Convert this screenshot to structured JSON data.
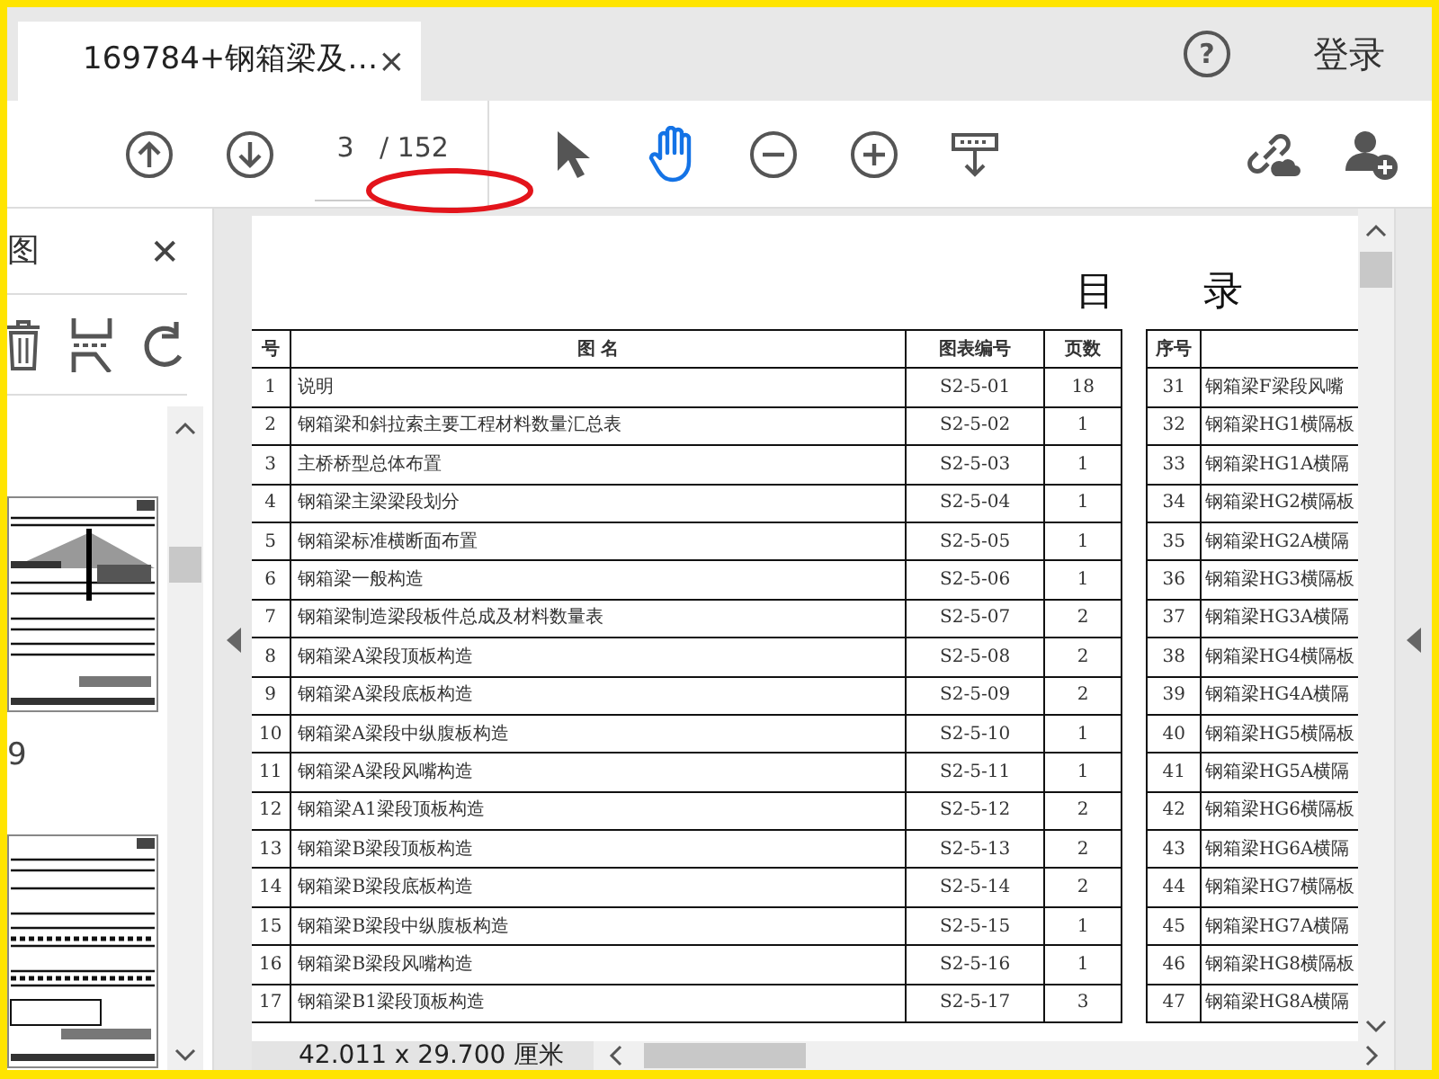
{
  "tab": {
    "title": "169784+钢箱梁及…",
    "close": "×",
    "selected": true
  },
  "header": {
    "help": "?",
    "sign_in": "登录"
  },
  "toolbar": {
    "page_current": "3",
    "page_total": "/ 152",
    "tools": [
      {
        "kind": "select",
        "selected": false
      },
      {
        "kind": "hand",
        "selected": true
      }
    ]
  },
  "sidebar": {
    "title": "图",
    "close": "✕",
    "thumbnail_labels": [
      "9"
    ]
  },
  "document": {
    "title": "目 录",
    "left_table": {
      "columns": [
        "号",
        "图 名",
        "图表编号",
        "页数"
      ],
      "rows": [
        [
          "1",
          "说明",
          "S2-5-01",
          "18"
        ],
        [
          "2",
          "钢箱梁和斜拉索主要工程材料数量汇总表",
          "S2-5-02",
          "1"
        ],
        [
          "3",
          "主桥桥型总体布置",
          "S2-5-03",
          "1"
        ],
        [
          "4",
          "钢箱梁主梁梁段划分",
          "S2-5-04",
          "1"
        ],
        [
          "5",
          "钢箱梁标准横断面布置",
          "S2-5-05",
          "1"
        ],
        [
          "6",
          "钢箱梁一般构造",
          "S2-5-06",
          "1"
        ],
        [
          "7",
          "钢箱梁制造梁段板件总成及材料数量表",
          "S2-5-07",
          "2"
        ],
        [
          "8",
          "钢箱梁A梁段顶板构造",
          "S2-5-08",
          "2"
        ],
        [
          "9",
          "钢箱梁A梁段底板构造",
          "S2-5-09",
          "2"
        ],
        [
          "10",
          "钢箱梁A梁段中纵腹板构造",
          "S2-5-10",
          "1"
        ],
        [
          "11",
          "钢箱梁A梁段风嘴构造",
          "S2-5-11",
          "1"
        ],
        [
          "12",
          "钢箱梁A1梁段顶板构造",
          "S2-5-12",
          "2"
        ],
        [
          "13",
          "钢箱梁B梁段顶板构造",
          "S2-5-13",
          "2"
        ],
        [
          "14",
          "钢箱梁B梁段底板构造",
          "S2-5-14",
          "2"
        ],
        [
          "15",
          "钢箱梁B梁段中纵腹板构造",
          "S2-5-15",
          "1"
        ],
        [
          "16",
          "钢箱梁B梁段风嘴构造",
          "S2-5-16",
          "1"
        ],
        [
          "17",
          "钢箱梁B1梁段顶板构造",
          "S2-5-17",
          "3"
        ]
      ]
    },
    "right_table": {
      "columns": [
        "序号"
      ],
      "rows": [
        [
          "31",
          "钢箱梁F梁段风嘴"
        ],
        [
          "32",
          "钢箱梁HG1横隔板"
        ],
        [
          "33",
          "钢箱梁HG1A横隔"
        ],
        [
          "34",
          "钢箱梁HG2横隔板"
        ],
        [
          "35",
          "钢箱梁HG2A横隔"
        ],
        [
          "36",
          "钢箱梁HG3横隔板"
        ],
        [
          "37",
          "钢箱梁HG3A横隔"
        ],
        [
          "38",
          "钢箱梁HG4横隔板"
        ],
        [
          "39",
          "钢箱梁HG4A横隔"
        ],
        [
          "40",
          "钢箱梁HG5横隔板"
        ],
        [
          "41",
          "钢箱梁HG5A横隔"
        ],
        [
          "42",
          "钢箱梁HG6横隔板"
        ],
        [
          "43",
          "钢箱梁HG6A横隔"
        ],
        [
          "44",
          "钢箱梁HG7横隔板"
        ],
        [
          "45",
          "钢箱梁HG7A横隔"
        ],
        [
          "46",
          "钢箱梁HG8横隔板"
        ],
        [
          "47",
          "钢箱梁HG8A横隔"
        ]
      ]
    }
  },
  "status_bar": {
    "page_size": "42.011 x 29.700 厘米"
  }
}
